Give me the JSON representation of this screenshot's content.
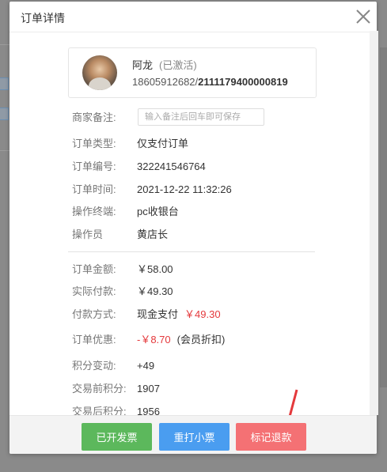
{
  "dialog": {
    "title": "订单详情"
  },
  "user": {
    "name": "阿龙",
    "status": "(已激活)",
    "phone": "18605912682/",
    "card": "2111179400000819"
  },
  "fields": {
    "note_label": "商家备注:",
    "note_placeholder": "输入备注后回车即可保存",
    "type_label": "订单类型:",
    "type_value": "仅支付订单",
    "number_label": "订单编号:",
    "number_value": "322241546764",
    "time_label": "订单时间:",
    "time_value": "2021-12-22 11:32:26",
    "terminal_label": "操作终端:",
    "terminal_value": "pc收银台",
    "operator_label": "操作员",
    "operator_value": "黄店长",
    "amount_label": "订单金额:",
    "amount_value": "￥58.00",
    "paid_label": "实际付款:",
    "paid_value": "￥49.30",
    "method_label": "付款方式:",
    "method_value": "现金支付",
    "method_amount": "￥49.30",
    "discount_label": "订单优惠:",
    "discount_value": "-￥8.70",
    "discount_note": "(会员折扣)",
    "points_change_label": "积分变动:",
    "points_change_value": "+49",
    "points_before_label": "交易前积分:",
    "points_before_value": "1907",
    "points_after_label": "交易后积分:",
    "points_after_value": "1956"
  },
  "footer": {
    "invoice_label": "已开发票",
    "reprint_label": "重打小票",
    "refund_label": "标记退款"
  },
  "colors": {
    "accent_red": "#e4393c",
    "green": "#5cb85c",
    "blue": "#4a9df0",
    "red_button": "#f47174"
  }
}
